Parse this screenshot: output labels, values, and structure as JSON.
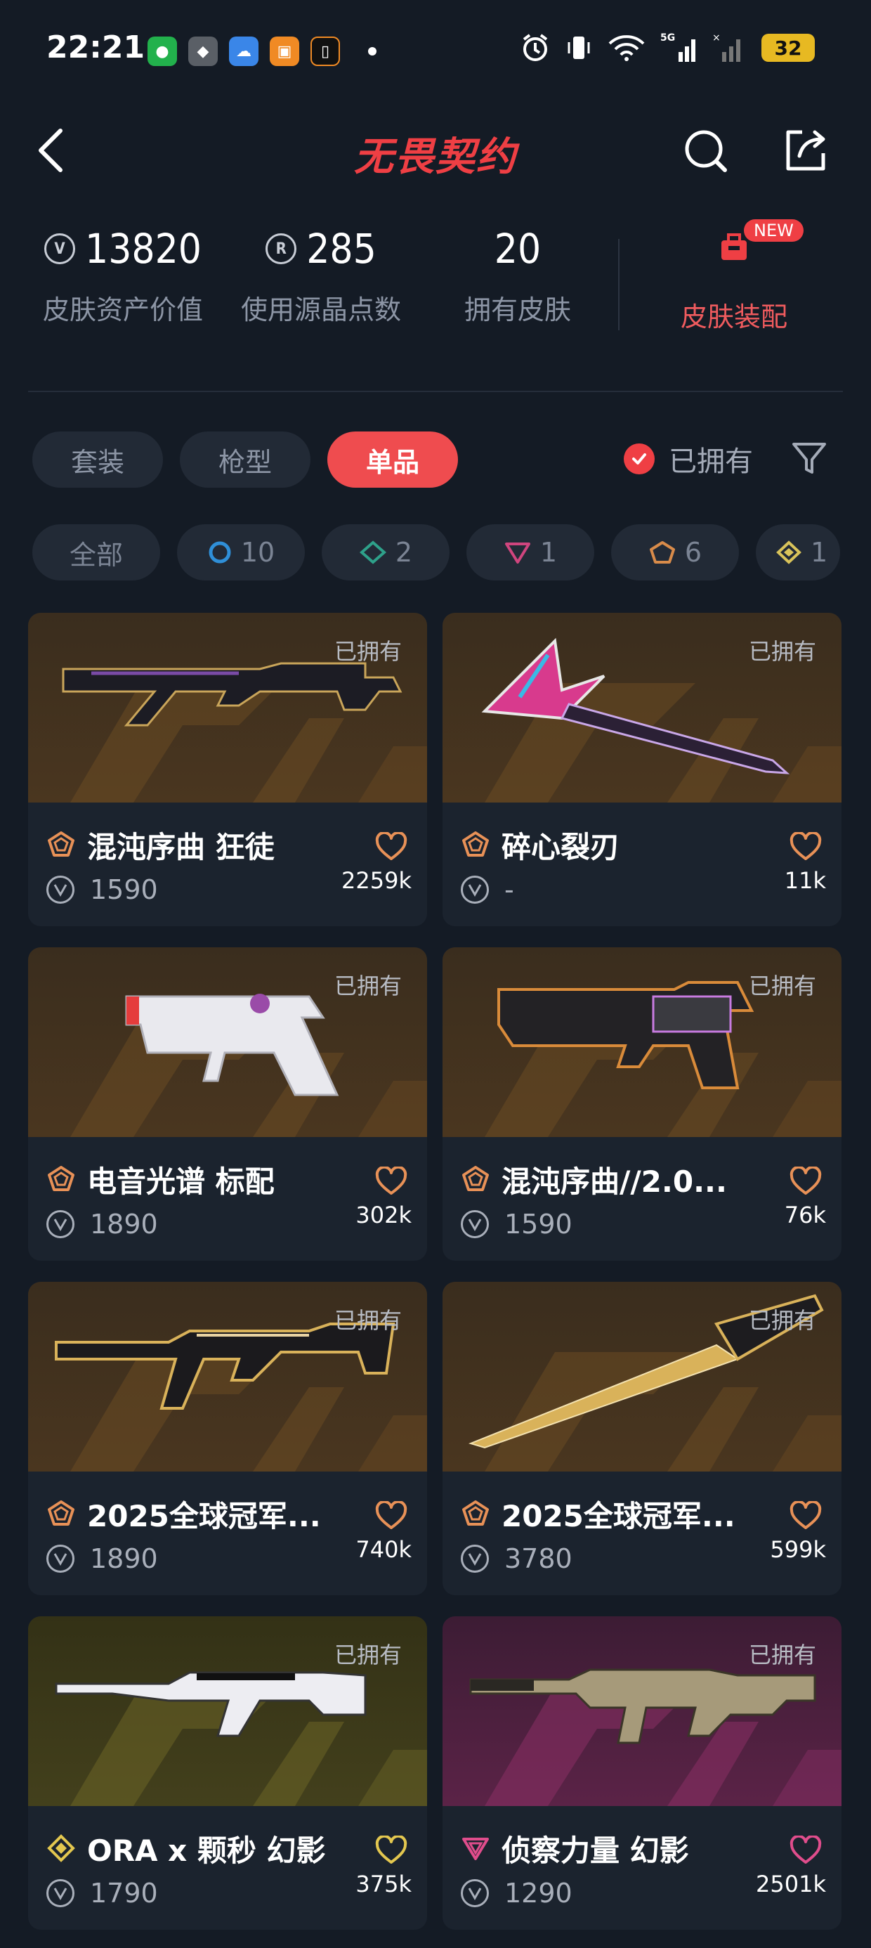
{
  "status_bar": {
    "time": "22:21",
    "battery": "32",
    "network": "5G"
  },
  "header": {
    "title": "无畏契约"
  },
  "stats": {
    "skin_value": {
      "value": "13820",
      "label": "皮肤资产价值"
    },
    "radianite": {
      "value": "285",
      "label": "使用源晶点数"
    },
    "owned": {
      "value": "20",
      "label": "拥有皮肤"
    },
    "equip": {
      "label": "皮肤装配",
      "badge": "NEW"
    }
  },
  "type_tabs": [
    {
      "label": "套装",
      "active": false
    },
    {
      "label": "枪型",
      "active": false
    },
    {
      "label": "单品",
      "active": true
    }
  ],
  "owned_toggle": {
    "label": "已拥有",
    "checked": true
  },
  "rarity_filters": [
    {
      "label": "全部"
    },
    {
      "count": "10",
      "color": "#2f8fd8"
    },
    {
      "count": "2",
      "color": "#2ea18a"
    },
    {
      "count": "1",
      "color": "#d0457e"
    },
    {
      "count": "6",
      "color": "#d88b4a"
    },
    {
      "count": "1",
      "color": "#d9c35a"
    }
  ],
  "cards": [
    {
      "name": "混沌序曲 狂徒",
      "price": "1590",
      "likes": "2259k",
      "owned": "已拥有",
      "tier_color": "#e89157",
      "heart_color": "#e89157",
      "bg": "gold"
    },
    {
      "name": "碎心裂刃",
      "price": "-",
      "likes": "11k",
      "owned": "已拥有",
      "tier_color": "#e89157",
      "heart_color": "#e89157",
      "bg": "gold"
    },
    {
      "name": "电音光谱 标配",
      "price": "1890",
      "likes": "302k",
      "owned": "已拥有",
      "tier_color": "#e89157",
      "heart_color": "#e89157",
      "bg": "gold"
    },
    {
      "name": "混沌序曲//2.0...",
      "price": "1590",
      "likes": "76k",
      "owned": "已拥有",
      "tier_color": "#e89157",
      "heart_color": "#e89157",
      "bg": "gold"
    },
    {
      "name": "2025全球冠军...",
      "price": "1890",
      "likes": "740k",
      "owned": "已拥有",
      "tier_color": "#e89157",
      "heart_color": "#e89157",
      "bg": "gold"
    },
    {
      "name": "2025全球冠军...",
      "price": "3780",
      "likes": "599k",
      "owned": "已拥有",
      "tier_color": "#e89157",
      "heart_color": "#e89157",
      "bg": "gold"
    },
    {
      "name": "ORA x 颗秒 幻影",
      "price": "1790",
      "likes": "375k",
      "owned": "已拥有",
      "tier_color": "#e3c74f",
      "heart_color": "#e3c74f",
      "bg": "olive"
    },
    {
      "name": "侦察力量 幻影",
      "price": "1290",
      "likes": "2501k",
      "owned": "已拥有",
      "tier_color": "#e04d8c",
      "heart_color": "#e04d8c",
      "bg": "pink"
    }
  ]
}
